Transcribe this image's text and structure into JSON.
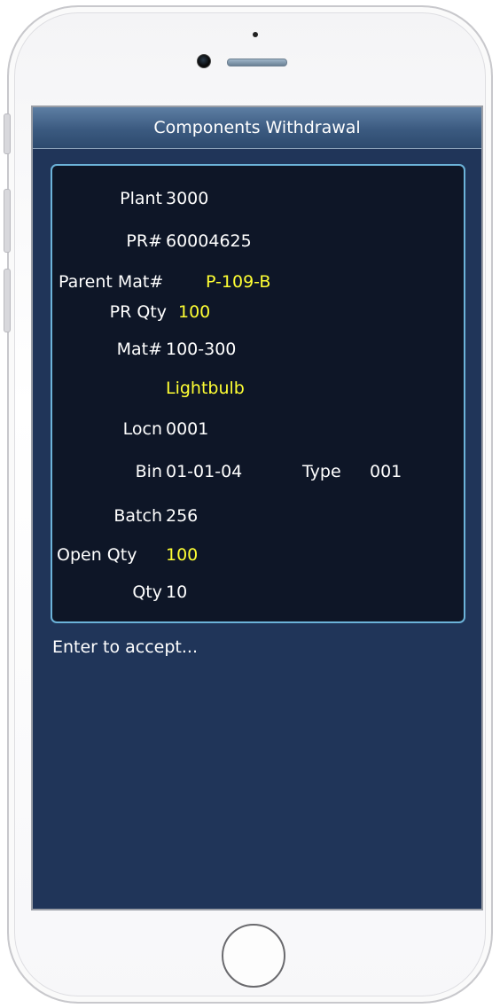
{
  "app": {
    "title": "Components Withdrawal"
  },
  "fields": {
    "plant": {
      "label": "Plant",
      "value": "3000"
    },
    "pr": {
      "label": "PR#",
      "value": "60004625"
    },
    "parent_mat": {
      "label": "Parent Mat#",
      "value": "P-109-B"
    },
    "pr_qty": {
      "label": "PR Qty",
      "value": "100"
    },
    "mat": {
      "label": "Mat#",
      "value": "100-300"
    },
    "mat_desc": {
      "value": "Lightbulb"
    },
    "locn": {
      "label": "Locn",
      "value": "0001"
    },
    "bin": {
      "label": "Bin",
      "value": "01-01-04"
    },
    "type": {
      "label": "Type",
      "value": "001"
    },
    "batch": {
      "label": "Batch",
      "value": "256"
    },
    "open_qty": {
      "label": "Open Qty",
      "value": "100"
    },
    "qty": {
      "label": "Qty",
      "value": "10"
    }
  },
  "prompt": "Enter to accept...",
  "colors": {
    "screen_bg": "#203559",
    "panel_bg": "#0e1627",
    "panel_border": "#6cb3d9",
    "highlight": "#ffff33",
    "text": "#ffffff"
  },
  "icons": {
    "home_button": "home-button-icon",
    "camera": "camera-icon",
    "speaker": "speaker-icon"
  }
}
